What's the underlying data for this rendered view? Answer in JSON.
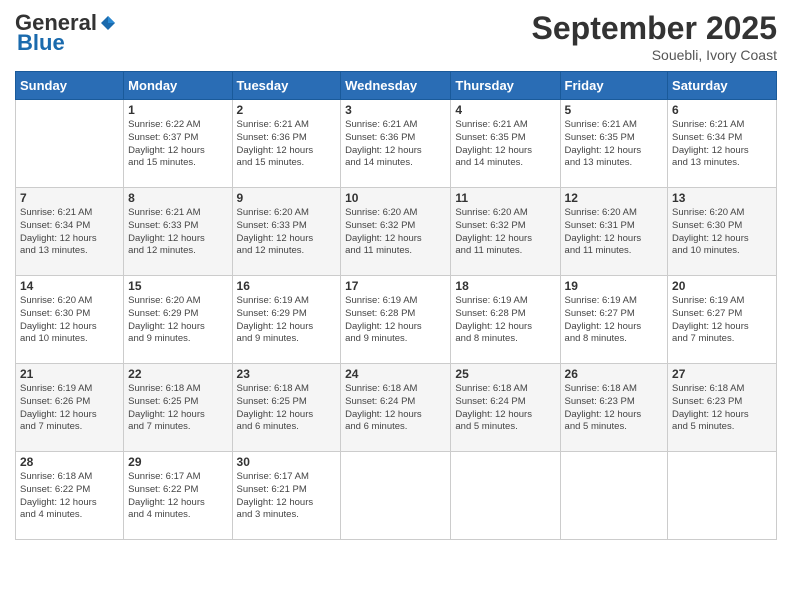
{
  "logo": {
    "general": "General",
    "blue": "Blue"
  },
  "header": {
    "month": "September 2025",
    "location": "Souebli, Ivory Coast"
  },
  "days_of_week": [
    "Sunday",
    "Monday",
    "Tuesday",
    "Wednesday",
    "Thursday",
    "Friday",
    "Saturday"
  ],
  "weeks": [
    [
      {
        "day": "",
        "info": ""
      },
      {
        "day": "1",
        "info": "Sunrise: 6:22 AM\nSunset: 6:37 PM\nDaylight: 12 hours\nand 15 minutes."
      },
      {
        "day": "2",
        "info": "Sunrise: 6:21 AM\nSunset: 6:36 PM\nDaylight: 12 hours\nand 15 minutes."
      },
      {
        "day": "3",
        "info": "Sunrise: 6:21 AM\nSunset: 6:36 PM\nDaylight: 12 hours\nand 14 minutes."
      },
      {
        "day": "4",
        "info": "Sunrise: 6:21 AM\nSunset: 6:35 PM\nDaylight: 12 hours\nand 14 minutes."
      },
      {
        "day": "5",
        "info": "Sunrise: 6:21 AM\nSunset: 6:35 PM\nDaylight: 12 hours\nand 13 minutes."
      },
      {
        "day": "6",
        "info": "Sunrise: 6:21 AM\nSunset: 6:34 PM\nDaylight: 12 hours\nand 13 minutes."
      }
    ],
    [
      {
        "day": "7",
        "info": "Sunrise: 6:21 AM\nSunset: 6:34 PM\nDaylight: 12 hours\nand 13 minutes."
      },
      {
        "day": "8",
        "info": "Sunrise: 6:21 AM\nSunset: 6:33 PM\nDaylight: 12 hours\nand 12 minutes."
      },
      {
        "day": "9",
        "info": "Sunrise: 6:20 AM\nSunset: 6:33 PM\nDaylight: 12 hours\nand 12 minutes."
      },
      {
        "day": "10",
        "info": "Sunrise: 6:20 AM\nSunset: 6:32 PM\nDaylight: 12 hours\nand 11 minutes."
      },
      {
        "day": "11",
        "info": "Sunrise: 6:20 AM\nSunset: 6:32 PM\nDaylight: 12 hours\nand 11 minutes."
      },
      {
        "day": "12",
        "info": "Sunrise: 6:20 AM\nSunset: 6:31 PM\nDaylight: 12 hours\nand 11 minutes."
      },
      {
        "day": "13",
        "info": "Sunrise: 6:20 AM\nSunset: 6:30 PM\nDaylight: 12 hours\nand 10 minutes."
      }
    ],
    [
      {
        "day": "14",
        "info": "Sunrise: 6:20 AM\nSunset: 6:30 PM\nDaylight: 12 hours\nand 10 minutes."
      },
      {
        "day": "15",
        "info": "Sunrise: 6:20 AM\nSunset: 6:29 PM\nDaylight: 12 hours\nand 9 minutes."
      },
      {
        "day": "16",
        "info": "Sunrise: 6:19 AM\nSunset: 6:29 PM\nDaylight: 12 hours\nand 9 minutes."
      },
      {
        "day": "17",
        "info": "Sunrise: 6:19 AM\nSunset: 6:28 PM\nDaylight: 12 hours\nand 9 minutes."
      },
      {
        "day": "18",
        "info": "Sunrise: 6:19 AM\nSunset: 6:28 PM\nDaylight: 12 hours\nand 8 minutes."
      },
      {
        "day": "19",
        "info": "Sunrise: 6:19 AM\nSunset: 6:27 PM\nDaylight: 12 hours\nand 8 minutes."
      },
      {
        "day": "20",
        "info": "Sunrise: 6:19 AM\nSunset: 6:27 PM\nDaylight: 12 hours\nand 7 minutes."
      }
    ],
    [
      {
        "day": "21",
        "info": "Sunrise: 6:19 AM\nSunset: 6:26 PM\nDaylight: 12 hours\nand 7 minutes."
      },
      {
        "day": "22",
        "info": "Sunrise: 6:18 AM\nSunset: 6:25 PM\nDaylight: 12 hours\nand 7 minutes."
      },
      {
        "day": "23",
        "info": "Sunrise: 6:18 AM\nSunset: 6:25 PM\nDaylight: 12 hours\nand 6 minutes."
      },
      {
        "day": "24",
        "info": "Sunrise: 6:18 AM\nSunset: 6:24 PM\nDaylight: 12 hours\nand 6 minutes."
      },
      {
        "day": "25",
        "info": "Sunrise: 6:18 AM\nSunset: 6:24 PM\nDaylight: 12 hours\nand 5 minutes."
      },
      {
        "day": "26",
        "info": "Sunrise: 6:18 AM\nSunset: 6:23 PM\nDaylight: 12 hours\nand 5 minutes."
      },
      {
        "day": "27",
        "info": "Sunrise: 6:18 AM\nSunset: 6:23 PM\nDaylight: 12 hours\nand 5 minutes."
      }
    ],
    [
      {
        "day": "28",
        "info": "Sunrise: 6:18 AM\nSunset: 6:22 PM\nDaylight: 12 hours\nand 4 minutes."
      },
      {
        "day": "29",
        "info": "Sunrise: 6:17 AM\nSunset: 6:22 PM\nDaylight: 12 hours\nand 4 minutes."
      },
      {
        "day": "30",
        "info": "Sunrise: 6:17 AM\nSunset: 6:21 PM\nDaylight: 12 hours\nand 3 minutes."
      },
      {
        "day": "",
        "info": ""
      },
      {
        "day": "",
        "info": ""
      },
      {
        "day": "",
        "info": ""
      },
      {
        "day": "",
        "info": ""
      }
    ]
  ]
}
